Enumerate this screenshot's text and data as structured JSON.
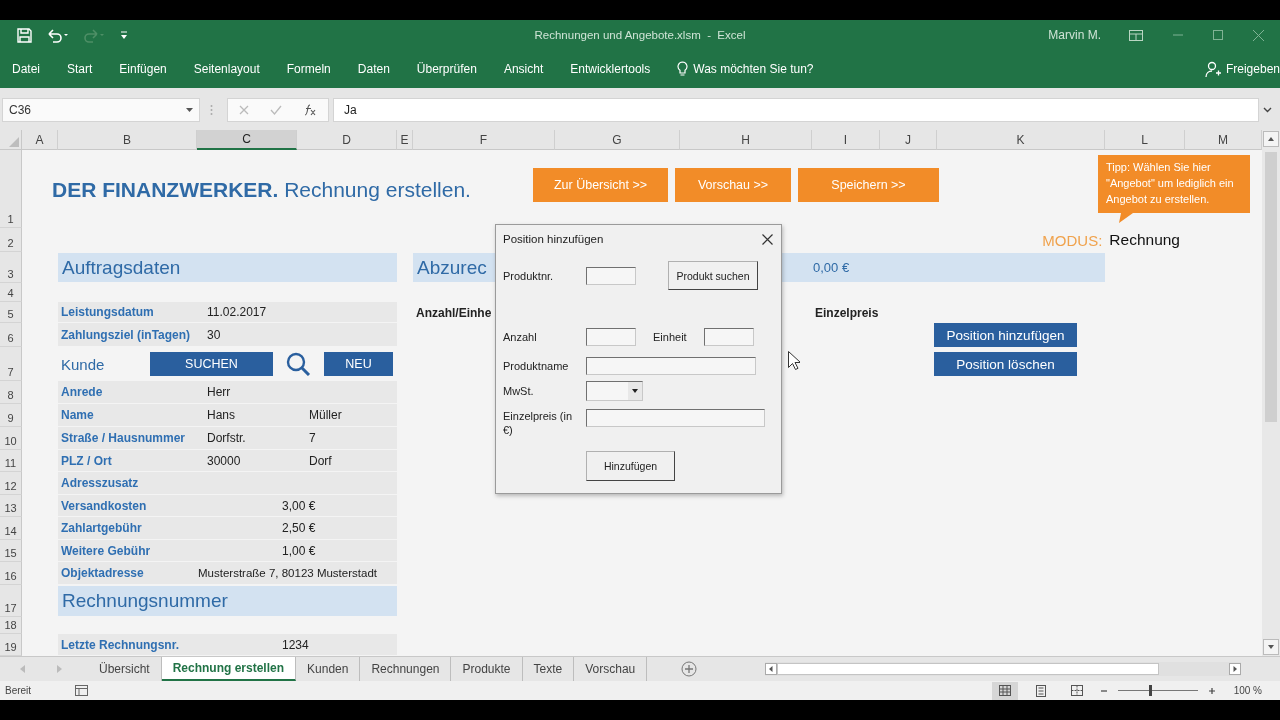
{
  "window": {
    "title": "Rechnungen und Angebote.xlsm  -  Excel",
    "user": "Marvin M."
  },
  "ribbon_tabs": [
    "Datei",
    "Start",
    "Einfügen",
    "Seitenlayout",
    "Formeln",
    "Daten",
    "Überprüfen",
    "Ansicht",
    "Entwicklertools"
  ],
  "tell_me": "Was möchten Sie tun?",
  "share": "Freigeben",
  "formula_bar": {
    "name_box": "C36",
    "value": "Ja"
  },
  "columns": [
    {
      "label": "A",
      "selected": false
    },
    {
      "label": "B",
      "selected": false
    },
    {
      "label": "C",
      "selected": true
    },
    {
      "label": "D",
      "selected": false
    },
    {
      "label": "E",
      "selected": false
    },
    {
      "label": "F",
      "selected": false
    },
    {
      "label": "G",
      "selected": false
    },
    {
      "label": "H",
      "selected": false
    },
    {
      "label": "I",
      "selected": false
    },
    {
      "label": "J",
      "selected": false
    },
    {
      "label": "K",
      "selected": false
    },
    {
      "label": "L",
      "selected": false
    },
    {
      "label": "M",
      "selected": false
    }
  ],
  "rows": [
    "1",
    "2",
    "3",
    "4",
    "5",
    "6",
    "7",
    "8",
    "9",
    "10",
    "11",
    "12",
    "13",
    "14",
    "15",
    "16",
    "17",
    "18",
    "19"
  ],
  "sheet": {
    "title": "**DER FINANZWERKER.** Rechnung erstellen.",
    "nav_buttons": [
      "Zur Übersicht >>",
      "Vorschau >>",
      "Speichern >>"
    ],
    "tip": "Tipp: Wählen Sie hier \"Angebot\" um lediglich ein Angebot zu erstellen.",
    "mode_label": "MODUS:",
    "mode_value": "Rechnung",
    "order_rows": [
      {
        "kind": "heading",
        "text": "Auftragsdaten"
      },
      {
        "kind": "field",
        "label": "Leistungsdatum",
        "value": "11.02.2017"
      },
      {
        "kind": "field",
        "label": "Zahlungsziel (inTagen)",
        "value": "30"
      },
      {
        "kind": "customer",
        "label": "Kunde",
        "search_button": "SUCHEN",
        "new_button": "NEU"
      },
      {
        "kind": "field",
        "label": "Anrede",
        "value": "Herr"
      },
      {
        "kind": "field",
        "label": "Name",
        "value": "Hans",
        "value2": "Müller"
      },
      {
        "kind": "field",
        "label": "Straße / Hausnummer",
        "value": "Dorfstr.",
        "value2": "7"
      },
      {
        "kind": "field",
        "label": "PLZ / Ort",
        "value": "30000",
        "value2": "Dorf"
      },
      {
        "kind": "field",
        "label": "Adresszusatz"
      },
      {
        "kind": "amount",
        "label": "Versandkosten",
        "value": "3,00 €"
      },
      {
        "kind": "amount",
        "label": "Zahlartgebühr",
        "value": "2,50 €"
      },
      {
        "kind": "amount",
        "label": "Weitere Gebühr",
        "value": "1,00 €"
      },
      {
        "kind": "wide",
        "label": "Objektadresse",
        "value": "Musterstraße 7, 80123 Musterstadt"
      },
      {
        "kind": "heading",
        "text": "Rechnungsnummer"
      },
      {
        "kind": "amount",
        "label": "Letzte Rechnungsnr.",
        "value": "1234"
      }
    ],
    "positions": {
      "heading": "Abzurec",
      "total": "0,00 €",
      "columns": [
        "Anzahl/Einhe",
        "Einzelpreis"
      ],
      "buttons": [
        "Position hinzufügen",
        "Position löschen"
      ]
    }
  },
  "dialog": {
    "title": "Position hinzufügen",
    "product_no_label": "Produktnr.",
    "search_button": "Produkt suchen",
    "quantity_label": "Anzahl",
    "unit_label": "Einheit",
    "name_label": "Produktname",
    "vat_label": "MwSt.",
    "price_label": "Einzelpreis (in €)",
    "submit_button": "Hinzufügen"
  },
  "sheet_tabs": [
    {
      "label": "Übersicht",
      "selected": false
    },
    {
      "label": "Rechnung erstellen",
      "selected": true
    },
    {
      "label": "Kunden",
      "selected": false
    },
    {
      "label": "Rechnungen",
      "selected": false
    },
    {
      "label": "Produkte",
      "selected": false
    },
    {
      "label": "Texte",
      "selected": false
    },
    {
      "label": "Vorschau",
      "selected": false
    }
  ],
  "status_bar": {
    "text": "Bereit",
    "zoom": {
      "level": 0.4,
      "reading": "100 %"
    }
  }
}
